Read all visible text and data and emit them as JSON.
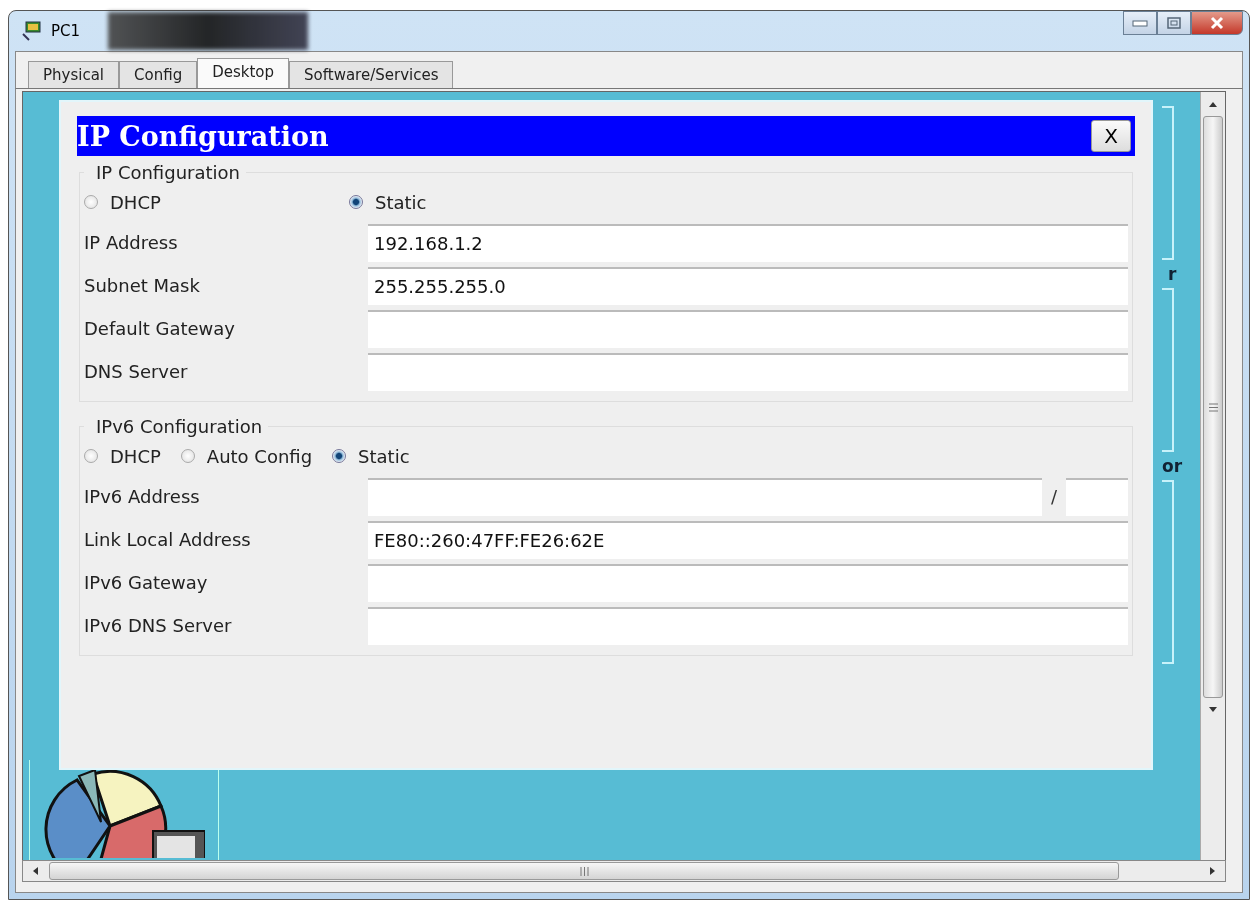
{
  "window": {
    "title": "PC1"
  },
  "tabs": [
    {
      "label": "Physical",
      "selected": false
    },
    {
      "label": "Config",
      "selected": false
    },
    {
      "label": "Desktop",
      "selected": true
    },
    {
      "label": "Software/Services",
      "selected": false
    }
  ],
  "desktop_fragments": [
    "r",
    "or"
  ],
  "dialog": {
    "title": "IP Configuration",
    "close": "X",
    "sections": [
      {
        "kind": "spread",
        "title": "IP Configuration",
        "modes": [
          {
            "label": "DHCP",
            "selected": false
          },
          {
            "label": "Static",
            "selected": true
          }
        ],
        "fields": [
          {
            "label": "IP Address",
            "value": "192.168.1.2"
          },
          {
            "label": "Subnet Mask",
            "value": "255.255.255.0"
          },
          {
            "label": "Default Gateway"
          },
          {
            "label": "DNS Server"
          }
        ]
      },
      {
        "kind": "inline",
        "title": "IPv6 Configuration",
        "modes": [
          {
            "label": "DHCP",
            "selected": false
          },
          {
            "label": "Auto Config",
            "selected": false
          },
          {
            "label": "Static",
            "selected": true
          }
        ],
        "fields": [
          {
            "label": "IPv6 Address",
            "separator": "/"
          },
          {
            "label": "Link Local Address",
            "value": "FE80::260:47FF:FE26:62E"
          },
          {
            "label": "IPv6 Gateway"
          },
          {
            "label": "IPv6 DNS Server"
          }
        ]
      }
    ]
  }
}
